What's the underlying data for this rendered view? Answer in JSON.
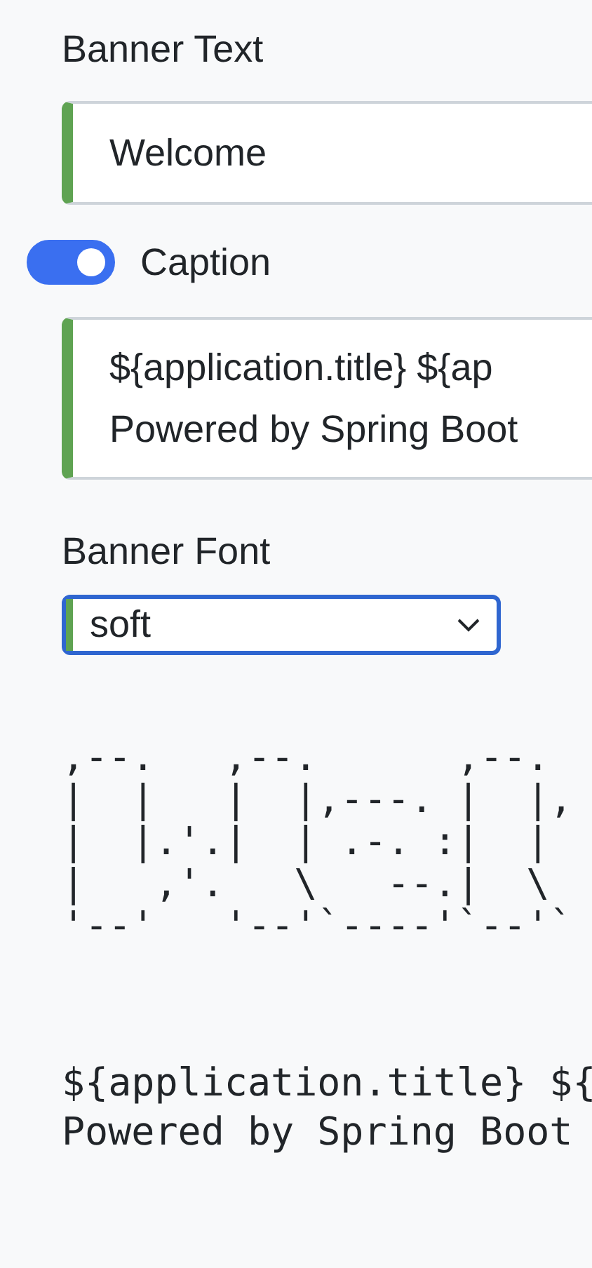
{
  "banner_text": {
    "label": "Banner Text",
    "value": "Welcome"
  },
  "caption": {
    "label": "Caption",
    "on": true,
    "lines": [
      "${application.title} ${ap",
      "Powered by Spring Boot"
    ]
  },
  "banner_font": {
    "label": "Banner Font",
    "value": "soft"
  },
  "preview": {
    "art_lines": [
      ",--.   ,--.      ,--.",
      "|  |   |  |,---. |  |,",
      "|  |.'.|  | .-. :|  |",
      "|   ,'.   \\   --.|  \\",
      "'--'   '--'`----'`--'`"
    ],
    "caption_lines": [
      "${application.title} ${",
      "Powered by Spring Boot"
    ]
  }
}
